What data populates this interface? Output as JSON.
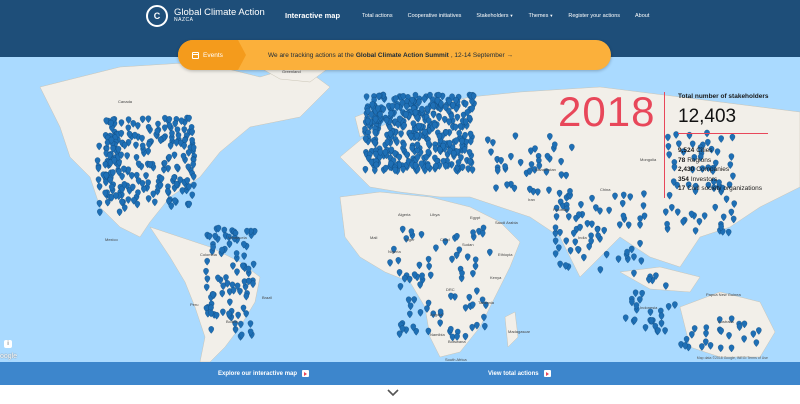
{
  "header": {
    "logo_title": "Global Climate Action",
    "logo_sub": "NAZCA",
    "logo_mark": "C",
    "nav": [
      {
        "label": "Interactive map",
        "active": true,
        "dropdown": false
      },
      {
        "label": "Total actions",
        "active": false,
        "dropdown": false
      },
      {
        "label": "Cooperative initiatives",
        "active": false,
        "dropdown": false
      },
      {
        "label": "Stakeholders",
        "active": false,
        "dropdown": true
      },
      {
        "label": "Themes",
        "active": false,
        "dropdown": true
      },
      {
        "label": "Register your actions",
        "active": false,
        "dropdown": false
      },
      {
        "label": "About",
        "active": false,
        "dropdown": false
      }
    ]
  },
  "banner": {
    "events_label": "Events",
    "text_before": "We are tracking actions at the",
    "text_bold": "Global Climate Action Summit",
    "text_after": ", 12-14 September →"
  },
  "stats": {
    "year": "2018",
    "title": "Total number of stakeholders",
    "total": "12,403",
    "rows": [
      {
        "value": "9,524",
        "label": "Cities"
      },
      {
        "value": "78",
        "label": "Regions"
      },
      {
        "value": "2,430",
        "label": "Companies"
      },
      {
        "value": "354",
        "label": "Investors"
      },
      {
        "value": "17",
        "label": "Civil society organizations"
      }
    ]
  },
  "map": {
    "labels": [
      "Greenland",
      "Canada",
      "Mexico",
      "Venezuela",
      "Colombia",
      "Peru",
      "Brazil",
      "Bolivia",
      "Algeria",
      "Libya",
      "Egypt",
      "Mali",
      "Niger",
      "Chad",
      "Sudan",
      "Nigeria",
      "Ethiopia",
      "DRC",
      "Kenya",
      "Angola",
      "Tanzania",
      "Namibia",
      "Botswana",
      "Madagascar",
      "South Africa",
      "Kazakhstan",
      "Mongolia",
      "China",
      "India",
      "Iran",
      "Saudi Arabia",
      "Pakistan",
      "Indonesia",
      "Papua New Guinea",
      "Australia"
    ],
    "footer": "Map data ©2018 Google, INEGI    Terms of Use",
    "google": "oogle",
    "info": "i",
    "ocean_color": "#aadaff",
    "land_color": "#f2efe9",
    "pin_color": "#1e6fb5"
  },
  "cta": {
    "explore": "Explore our interactive map",
    "view": "View total actions"
  }
}
